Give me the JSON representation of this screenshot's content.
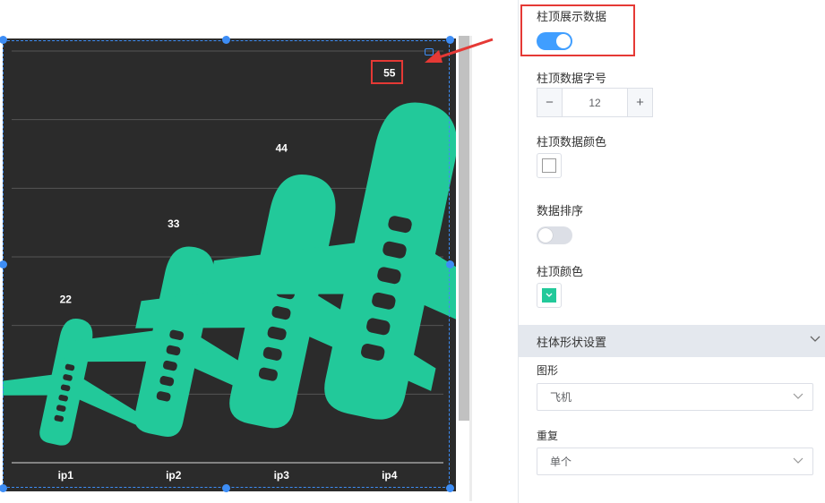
{
  "chart_data": {
    "type": "bar",
    "shape": "airplane",
    "categories": [
      "ip1",
      "ip2",
      "ip3",
      "ip4"
    ],
    "values": [
      22,
      33,
      44,
      55
    ],
    "ylim": [
      0,
      60
    ],
    "grid": true,
    "bar_color": "#22c99a",
    "background": "#2b2b2b"
  },
  "panel": {
    "show_top_label": {
      "label": "柱顶展示数据",
      "enabled": true
    },
    "top_label_font_size": {
      "label": "柱顶数据字号",
      "value": "12",
      "minus": "−",
      "plus": "+"
    },
    "top_label_color": {
      "label": "柱顶数据颜色",
      "color": "#ffffff"
    },
    "data_sort": {
      "label": "数据排序",
      "enabled": false
    },
    "bar_top_color": {
      "label": "柱顶颜色",
      "color": "#22c99a"
    },
    "shape_section": {
      "title": "柱体形状设置",
      "shape_label": "图形",
      "shape_value": "飞机",
      "repeat_label": "重复",
      "repeat_value": "单个"
    }
  },
  "colors": {
    "accent": "#409eff",
    "highlight": "#e53935"
  }
}
